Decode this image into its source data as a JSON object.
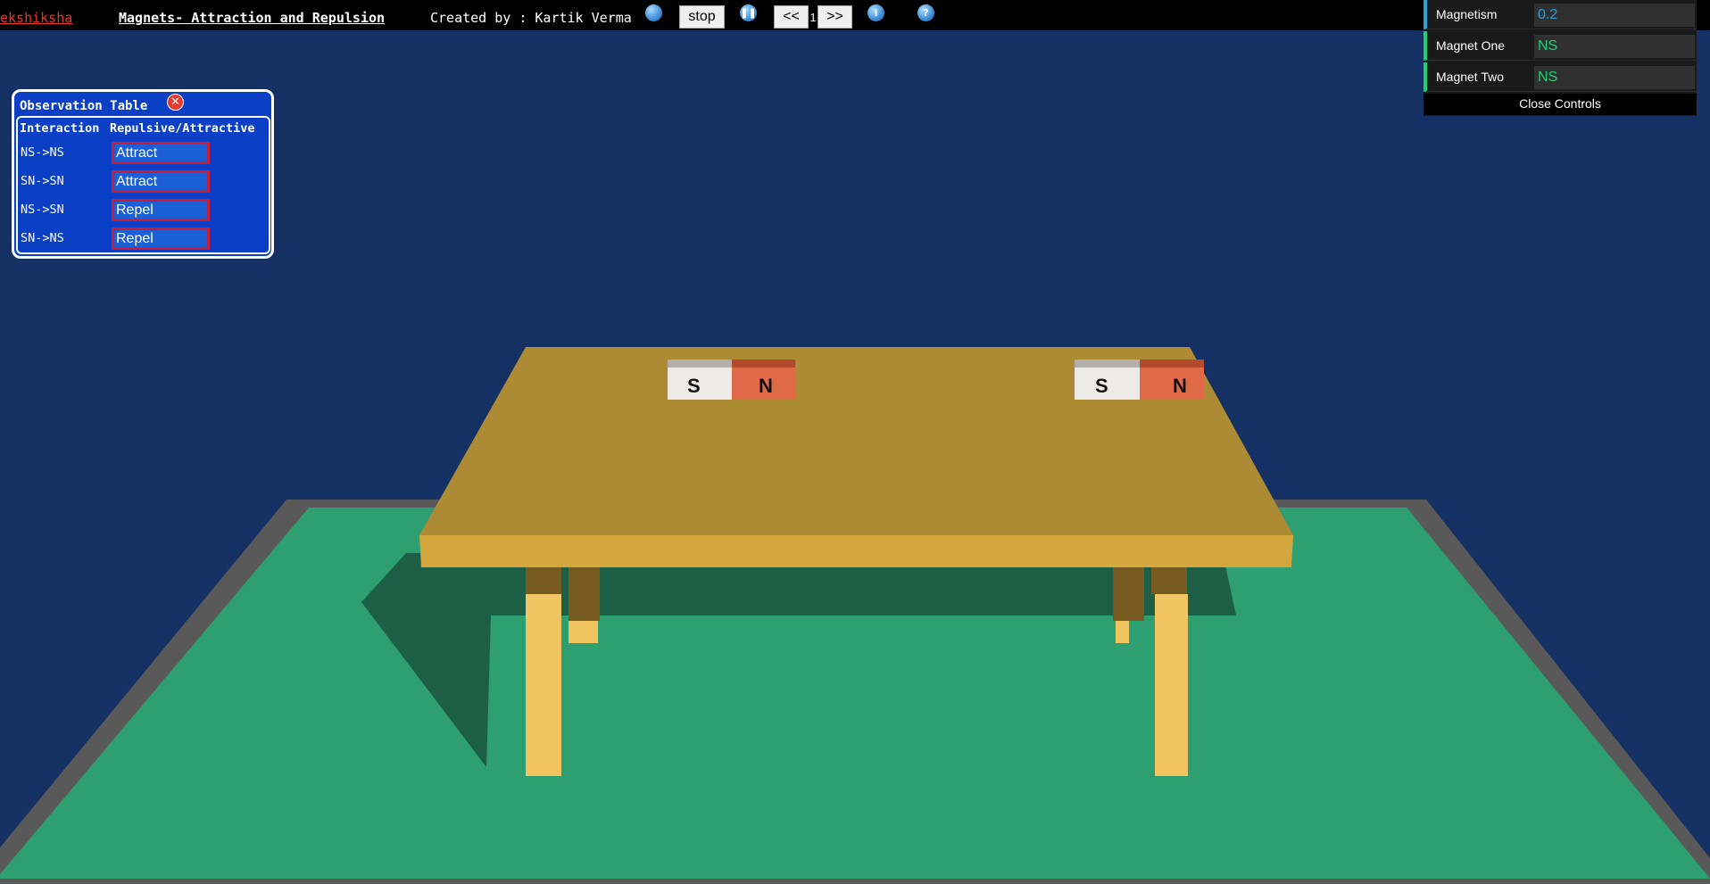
{
  "topbar": {
    "brand": "ekshiksha",
    "title": "Magnets- Attraction and Repulsion",
    "credit": "Created by : Kartik Verma",
    "stop_label": "stop",
    "prev_label": "<<",
    "page_number": "1",
    "next_label": ">>",
    "info_glyph": "i",
    "help_glyph": "?"
  },
  "icons": {
    "globe": "globe-icon",
    "pause": "pause-icon",
    "info": "info-icon",
    "help": "help-icon",
    "close": "close-icon"
  },
  "controls": {
    "magnetism_label": "Magnetism",
    "magnetism_value": "0.2",
    "magnet_one_label": "Magnet One",
    "magnet_one_value": "NS",
    "magnet_two_label": "Magnet Two",
    "magnet_two_value": "NS",
    "close_label": "Close Controls"
  },
  "observation": {
    "title": "Observation Table",
    "header_interaction": "Interaction",
    "header_result": "Repulsive/Attractive",
    "rows": [
      {
        "interaction": "NS->NS",
        "result": "Attract"
      },
      {
        "interaction": "SN->SN",
        "result": "Attract"
      },
      {
        "interaction": "NS->SN",
        "result": "Repel"
      },
      {
        "interaction": "SN->NS",
        "result": "Repel"
      }
    ]
  },
  "scene": {
    "magnet_left": {
      "s_label": "S",
      "n_label": "N"
    },
    "magnet_right": {
      "s_label": "S",
      "n_label": "N"
    }
  },
  "colors": {
    "background": "#153062",
    "floor": "#2e9f70",
    "table_top": "#ad8a34",
    "table_edge": "#d3a73d",
    "magnet_north": "#e06a48",
    "magnet_south": "#eeeae8",
    "accent_green": "#1ed36f",
    "accent_blue": "#2fa1d6"
  }
}
